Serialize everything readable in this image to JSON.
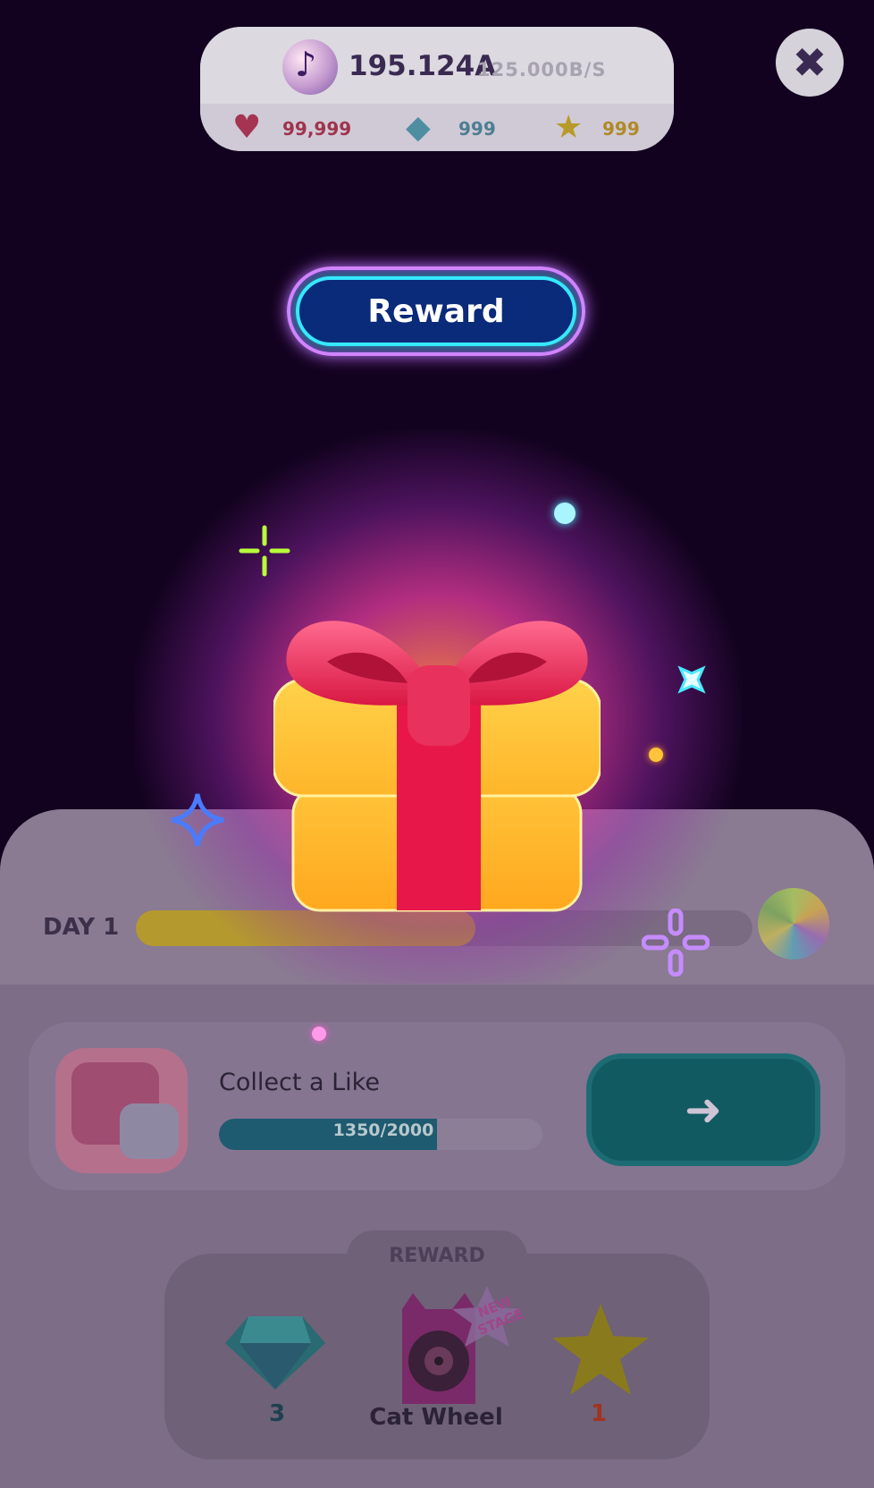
{
  "header": {
    "score": "195.124A",
    "rate": "125.000B/S",
    "currencies": [
      {
        "icon": "heart-icon",
        "value": "99,999",
        "color": "#a0344c"
      },
      {
        "icon": "gem-icon",
        "value": "999",
        "color": "#4e7e92"
      },
      {
        "icon": "star-icon",
        "value": "999",
        "color": "#b08a2a"
      }
    ],
    "close_icon": "close-icon"
  },
  "reward_sign": {
    "label": "Reward"
  },
  "progress": {
    "day_label": "DAY 1",
    "day_fraction": 0.55,
    "end_icon": "disco-ball-icon"
  },
  "mission": {
    "title": "Collect a Like",
    "progress_text": "1350/2000",
    "progress_fraction": 0.675,
    "go_icon": "arrow-right-icon"
  },
  "rewards": {
    "heading": "REWARD",
    "items": [
      {
        "icon": "gem-icon",
        "label": "3",
        "color": "#1e4050"
      },
      {
        "icon": "cat-wheel-icon",
        "label": "Cat Wheel",
        "badge": "NEW STAGE",
        "color": "#2c2238"
      },
      {
        "icon": "star-icon",
        "label": "1",
        "color": "#a0341e"
      }
    ]
  },
  "colors": {
    "background": "#12021f",
    "neon_outer": "#e07cff",
    "neon_inner": "#36e8ff",
    "gift_box": "#ffb830",
    "gift_ribbon": "#e8174a"
  }
}
